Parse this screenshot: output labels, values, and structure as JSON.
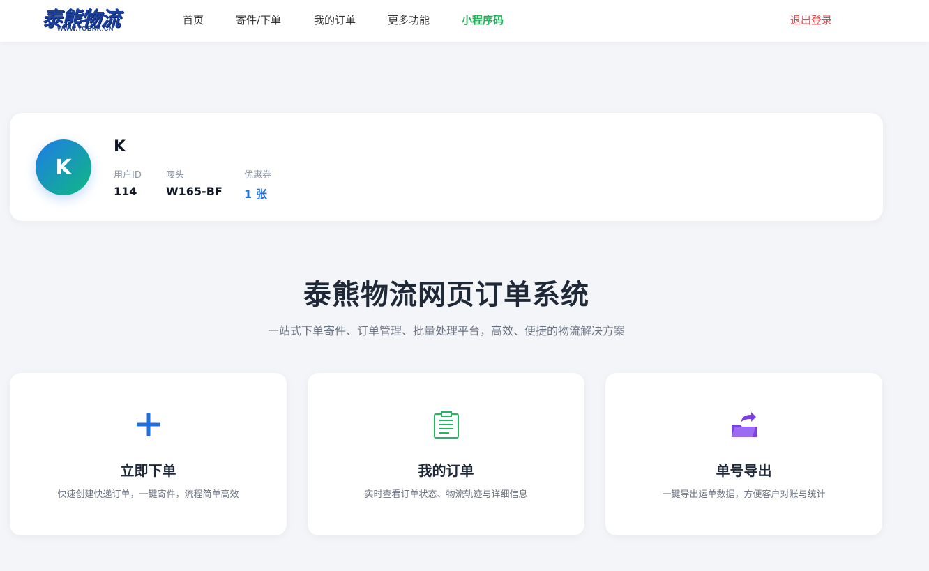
{
  "brand": {
    "logo_text": "泰熊物流",
    "logo_url_text": "WWW.TOBKK.CN"
  },
  "nav": {
    "items": [
      {
        "label": "首页"
      },
      {
        "label": "寄件/下单"
      },
      {
        "label": "我的订单"
      },
      {
        "label": "更多功能"
      },
      {
        "label": "小程序码"
      }
    ],
    "logout_label": "退出登录"
  },
  "profile": {
    "avatar_letter": "K",
    "name": "K",
    "stats": [
      {
        "label": "用户ID",
        "value": "114"
      },
      {
        "label": "唛头",
        "value": "W165-BF"
      },
      {
        "label": "优惠券",
        "value": "1 张"
      }
    ]
  },
  "hero": {
    "title": "泰熊物流网页订单系统",
    "subtitle": "一站式下单寄件、订单管理、批量处理平台，高效、便捷的物流解决方案"
  },
  "features": [
    {
      "icon": "plus-icon",
      "title": "立即下单",
      "desc": "快速创建快递订单，一键寄件，流程简单高效",
      "color": "#1e6fe0"
    },
    {
      "icon": "clipboard-icon",
      "title": "我的订单",
      "desc": "实时查看订单状态、物流轨迹与详细信息",
      "color": "#22b862"
    },
    {
      "icon": "folder-export-icon",
      "title": "单号导出",
      "desc": "一键导出运单数据，方便客户对账与统计",
      "color": "#7b3fe4"
    }
  ],
  "colors": {
    "accent_blue": "#1e6fe0",
    "accent_green": "#1fb25a",
    "logout_red": "#e5484d",
    "background": "#f3f5f8"
  }
}
